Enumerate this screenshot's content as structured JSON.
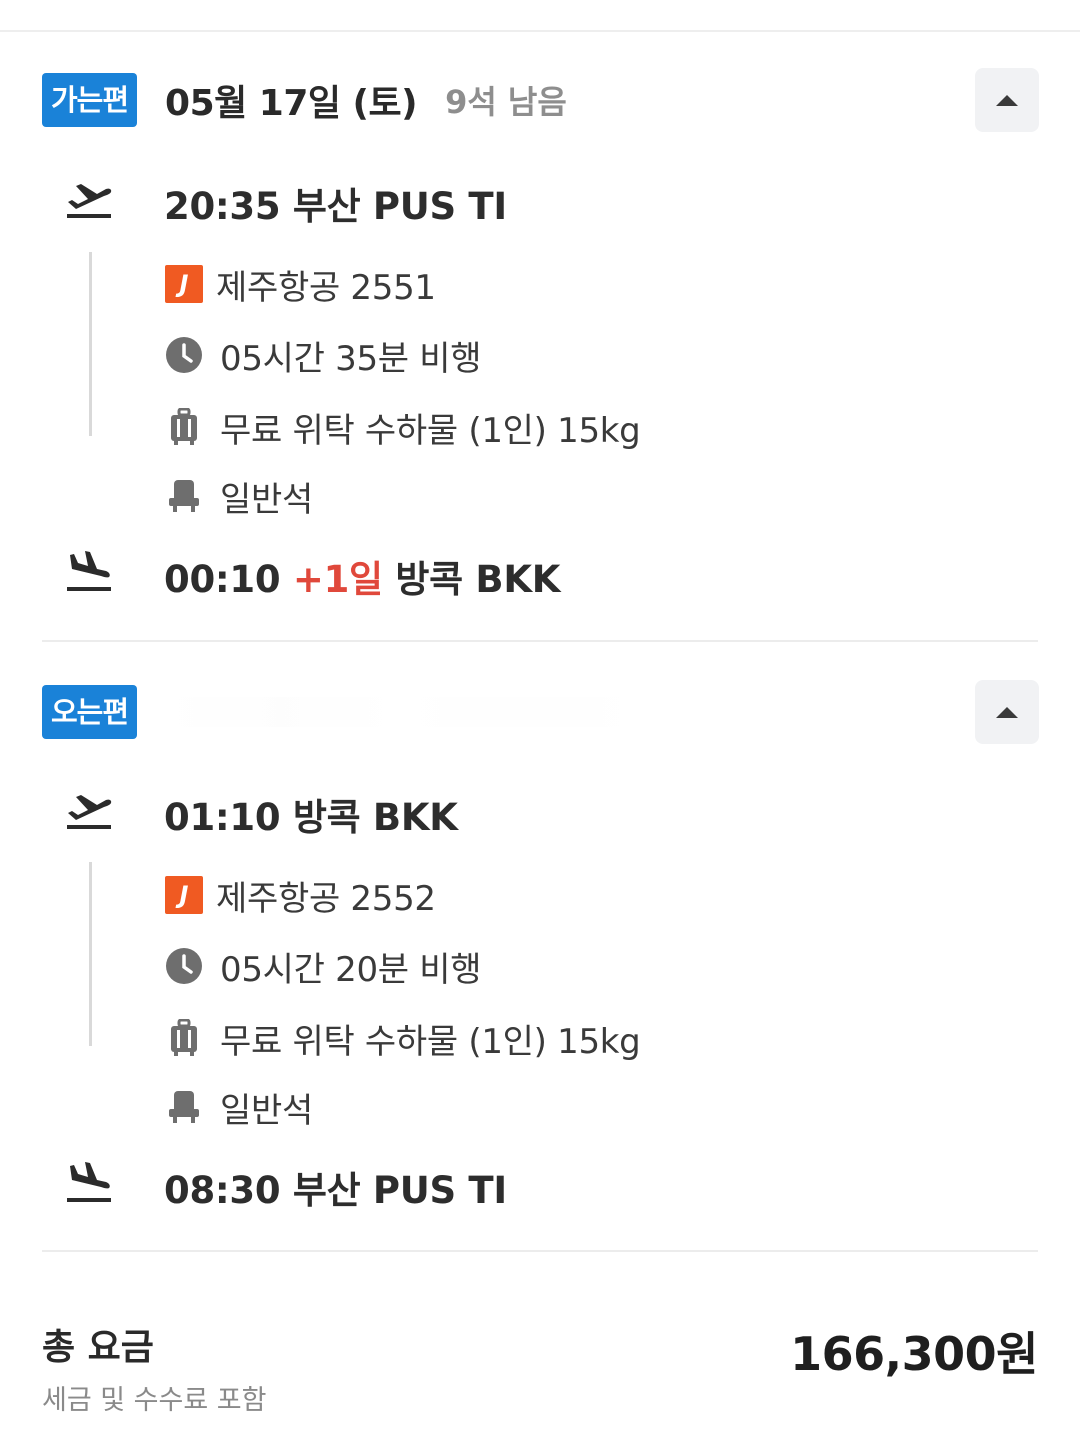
{
  "outbound": {
    "badge": "가는편",
    "date": "05월 17일 (토)",
    "seats_left": "9석 남음",
    "departure": {
      "time_text": "20:35 부산 PUS TI"
    },
    "airline": "제주항공 2551",
    "airline_logo_letter": "J",
    "duration": "05시간 35분 비행",
    "baggage": "무료 위탁 수하물 (1인) 15kg",
    "cabin": "일반석",
    "arrival": {
      "time": "00:10",
      "plus_day": "+1일",
      "place": "방콕 BKK"
    }
  },
  "inbound": {
    "badge": "오는편",
    "departure": {
      "time_text": "01:10 방콕 BKK"
    },
    "airline": "제주항공 2552",
    "airline_logo_letter": "J",
    "duration": "05시간 20분 비행",
    "baggage": "무료 위탁 수하물 (1인) 15kg",
    "cabin": "일반석",
    "arrival": {
      "time_text": "08:30 부산 PUS TI"
    }
  },
  "total": {
    "label": "총 요금",
    "sub": "세금 및 수수료 포함",
    "price": "166,300원"
  },
  "colors": {
    "badge_bg": "#1a82d8",
    "plus_day": "#e0483b",
    "jeju_brand": "#f05a22"
  }
}
